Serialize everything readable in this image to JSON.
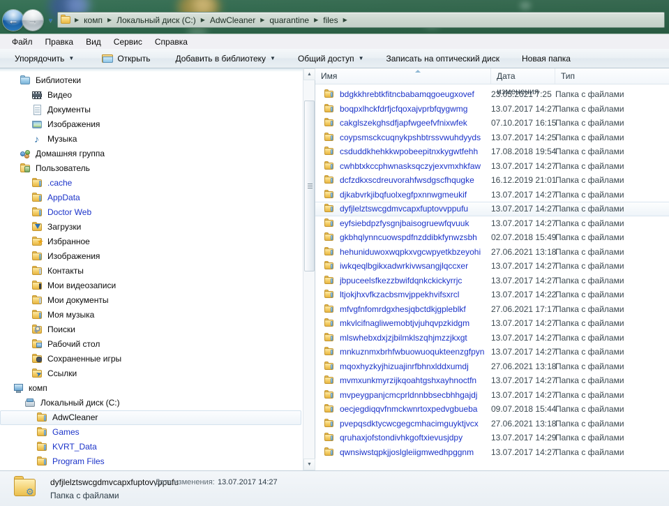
{
  "titlebar": {
    "back_glyph": "←",
    "forward_glyph": "→",
    "history_glyph": "▼",
    "folder_icon": "folder-icon",
    "separator": "▶",
    "breadcrumbs": [
      "комп",
      "Локальный диск (C:)",
      "AdwCleaner",
      "quarantine",
      "files"
    ]
  },
  "menubar": {
    "items": [
      "Файл",
      "Правка",
      "Вид",
      "Сервис",
      "Справка"
    ]
  },
  "toolbar": {
    "caret": "▼",
    "organize": "Упорядочить",
    "open": "Открыть",
    "add_to_library": "Добавить в библиотеку",
    "share": "Общий доступ",
    "burn": "Записать на оптический диск",
    "new_folder": "Новая папка"
  },
  "navpane": {
    "scroll_up_glyph": "▲",
    "scroll_down_glyph": "▼",
    "items": [
      {
        "label": "Библиотеки",
        "icon": "libraries-icon",
        "indent": 28,
        "color": "black",
        "selected": false
      },
      {
        "label": "Видео",
        "icon": "video-icon",
        "indent": 45,
        "color": "black",
        "selected": false
      },
      {
        "label": "Документы",
        "icon": "documents-icon",
        "indent": 45,
        "color": "black",
        "selected": false
      },
      {
        "label": "Изображения",
        "icon": "pictures-icon",
        "indent": 45,
        "color": "black",
        "selected": false
      },
      {
        "label": "Музыка",
        "icon": "music-icon",
        "indent": 45,
        "color": "black",
        "selected": false
      },
      {
        "label": "Домашняя группа",
        "icon": "homegroup-icon",
        "indent": 28,
        "color": "black",
        "selected": false
      },
      {
        "label": "Пользователь",
        "icon": "user-icon",
        "indent": 28,
        "color": "black",
        "selected": false
      },
      {
        "label": ".cache",
        "icon": "folder-icon",
        "indent": 45,
        "color": "blue",
        "selected": false
      },
      {
        "label": "AppData",
        "icon": "folder-icon",
        "indent": 45,
        "color": "blue",
        "selected": false
      },
      {
        "label": "Doctor Web",
        "icon": "folder-icon",
        "indent": 45,
        "color": "blue",
        "selected": false
      },
      {
        "label": "Загрузки",
        "icon": "downloads-icon",
        "indent": 45,
        "color": "black",
        "selected": false
      },
      {
        "label": "Избранное",
        "icon": "favorites-icon",
        "indent": 45,
        "color": "black",
        "selected": false
      },
      {
        "label": "Изображения",
        "icon": "pictures-folder-icon",
        "indent": 45,
        "color": "black",
        "selected": false
      },
      {
        "label": "Контакты",
        "icon": "contacts-icon",
        "indent": 45,
        "color": "black",
        "selected": false
      },
      {
        "label": "Мои видеозаписи",
        "icon": "my-videos-icon",
        "indent": 45,
        "color": "black",
        "selected": false
      },
      {
        "label": "Мои документы",
        "icon": "my-documents-icon",
        "indent": 45,
        "color": "black",
        "selected": false
      },
      {
        "label": "Моя музыка",
        "icon": "my-music-icon",
        "indent": 45,
        "color": "black",
        "selected": false
      },
      {
        "label": "Поиски",
        "icon": "searches-icon",
        "indent": 45,
        "color": "black",
        "selected": false
      },
      {
        "label": "Рабочий стол",
        "icon": "desktop-icon",
        "indent": 45,
        "color": "black",
        "selected": false
      },
      {
        "label": "Сохраненные игры",
        "icon": "saved-games-icon",
        "indent": 45,
        "color": "black",
        "selected": false
      },
      {
        "label": "Ссылки",
        "icon": "links-icon",
        "indent": 45,
        "color": "black",
        "selected": false
      },
      {
        "label": "комп",
        "icon": "computer-icon",
        "indent": 18,
        "color": "black",
        "selected": false
      },
      {
        "label": "Локальный диск (C:)",
        "icon": "disk-icon",
        "indent": 35,
        "color": "black",
        "selected": false
      },
      {
        "label": "AdwCleaner",
        "icon": "folder-icon",
        "indent": 52,
        "color": "black",
        "selected": true
      },
      {
        "label": "Games",
        "icon": "folder-icon",
        "indent": 52,
        "color": "blue",
        "selected": false
      },
      {
        "label": "KVRT_Data",
        "icon": "folder-icon",
        "indent": 52,
        "color": "blue",
        "selected": false
      },
      {
        "label": "Program Files",
        "icon": "folder-icon",
        "indent": 52,
        "color": "blue",
        "selected": false
      }
    ]
  },
  "filelist": {
    "columns": [
      "Имя",
      "Дата изменения",
      "Тип"
    ],
    "sort_indicator": "ascending",
    "rows": [
      {
        "name": "bdgkkhrebtkfitncbabamqgoeugxovef",
        "date": "23.05.2021 7:25",
        "type": "Папка с файлами",
        "selected": false
      },
      {
        "name": "boqpxlhckfdrfjcfqoxajvprbfqygwmg",
        "date": "13.07.2017 14:27",
        "type": "Папка с файлами",
        "selected": false
      },
      {
        "name": "cakglszekghsdfjapfwgeefvfnixwfek",
        "date": "07.10.2017 16:15",
        "type": "Папка с файлами",
        "selected": false
      },
      {
        "name": "coypsmsckcuqnykpshbtrssvwuhdyyds",
        "date": "13.07.2017 14:25",
        "type": "Папка с файлами",
        "selected": false
      },
      {
        "name": "csduddkhehkkwpobeepitnxkygwtfehh",
        "date": "17.08.2018 19:54",
        "type": "Папка с файлами",
        "selected": false
      },
      {
        "name": "cwhbtxkccphwnasksqczyjexvmxhkfaw",
        "date": "13.07.2017 14:27",
        "type": "Папка с файлами",
        "selected": false
      },
      {
        "name": "dcfzdkxscdreuvorahfwsdgscfhqugke",
        "date": "16.12.2019 21:01",
        "type": "Папка с файлами",
        "selected": false
      },
      {
        "name": "djkabvrkjibqfuolxegfpxnnwgmeukif",
        "date": "13.07.2017 14:27",
        "type": "Папка с файлами",
        "selected": false
      },
      {
        "name": "dyfjlelztswcgdmvcapxfuptovvppufu",
        "date": "13.07.2017 14:27",
        "type": "Папка с файлами",
        "selected": true
      },
      {
        "name": "eyfsiebdpzfysgnjbaisogruewfqvuuk",
        "date": "13.07.2017 14:27",
        "type": "Папка с файлами",
        "selected": false
      },
      {
        "name": "gkbhqlynncuowspdfnzddibkfynwzsbh",
        "date": "02.07.2018 15:49",
        "type": "Папка с файлами",
        "selected": false
      },
      {
        "name": "hehuniduwoxwqpkxvgcwpyetkbzeyohi",
        "date": "27.06.2021 13:18",
        "type": "Папка с файлами",
        "selected": false
      },
      {
        "name": "iwkqeqlbgikxadwrkivwsangjlqccxer",
        "date": "13.07.2017 14:27",
        "type": "Папка с файлами",
        "selected": false
      },
      {
        "name": "jbpuceelsfkezzbwifdqnkckickyrrjc",
        "date": "13.07.2017 14:27",
        "type": "Папка с файлами",
        "selected": false
      },
      {
        "name": "ltjokjhxvfkzacbsmvjppekhvifsxrcl",
        "date": "13.07.2017 14:22",
        "type": "Папка с файлами",
        "selected": false
      },
      {
        "name": "mfvgfnfomrdgxhesjqbctdkjgpleblkf",
        "date": "27.06.2021 17:17",
        "type": "Папка с файлами",
        "selected": false
      },
      {
        "name": "mkvlcifnagliwemobtjvjuhqvpzkidgm",
        "date": "13.07.2017 14:27",
        "type": "Папка с файлами",
        "selected": false
      },
      {
        "name": "mlswhebxdxjzjbilmklszqhjmzzjkxgt",
        "date": "13.07.2017 14:27",
        "type": "Папка с файлами",
        "selected": false
      },
      {
        "name": "mnkuznmxbrhfwbuowuoqukteenzgfpyn",
        "date": "13.07.2017 14:27",
        "type": "Папка с файлами",
        "selected": false
      },
      {
        "name": "mqoxhyzkyjhizuajinrfbhnxlddxumdj",
        "date": "27.06.2021 13:18",
        "type": "Папка с файлами",
        "selected": false
      },
      {
        "name": "mvmxunkmyrzijkqoahtgshxayhnoctfn",
        "date": "13.07.2017 14:27",
        "type": "Папка с файлами",
        "selected": false
      },
      {
        "name": "mvpeygpanjcmcprldnnbbsecbhhgajdj",
        "date": "13.07.2017 14:27",
        "type": "Папка с файлами",
        "selected": false
      },
      {
        "name": "oecjegdiqqvfnmckwnrtoxpedvgbueba",
        "date": "09.07.2018 15:44",
        "type": "Папка с файлами",
        "selected": false
      },
      {
        "name": "pvepqsdktycwcgegcmhacimguyktjvcx",
        "date": "27.06.2021 13:18",
        "type": "Папка с файлами",
        "selected": false
      },
      {
        "name": "qruhaxjofstondivhkgoftxievusjdpy",
        "date": "13.07.2017 14:29",
        "type": "Папка с файлами",
        "selected": false
      },
      {
        "name": "qwnsiwstqpkjjoslgleiigmwedhpggnm",
        "date": "13.07.2017 14:27",
        "type": "Папка с файлами",
        "selected": false
      }
    ]
  },
  "statusbar": {
    "icon": "folder-properties-icon",
    "gear_glyph": "⚙",
    "name": "dyfjlelztswcgdmvcapxfuptovvppufu",
    "date_label": "Дата изменения:",
    "date_value": "13.07.2017 14:27",
    "type": "Папка с файлами"
  }
}
